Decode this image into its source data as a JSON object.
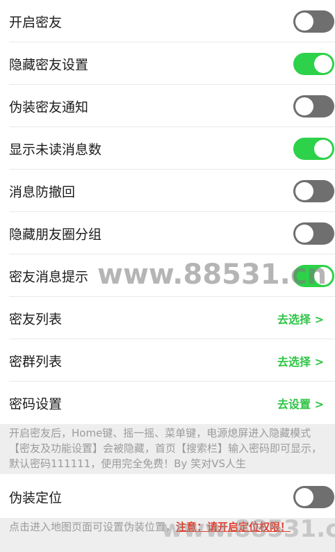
{
  "settings": [
    {
      "label": "开启密友",
      "type": "toggle",
      "on": false
    },
    {
      "label": "隐藏密友设置",
      "type": "toggle",
      "on": true
    },
    {
      "label": "伪装密友通知",
      "type": "toggle",
      "on": false
    },
    {
      "label": "显示未读消息数",
      "type": "toggle",
      "on": true
    },
    {
      "label": "消息防撤回",
      "type": "toggle",
      "on": false
    },
    {
      "label": "隐藏朋友圈分组",
      "type": "toggle",
      "on": false
    },
    {
      "label": "密友消息提示",
      "type": "toggle",
      "on": true
    },
    {
      "label": "密友列表",
      "type": "link",
      "action": "去选择 >"
    },
    {
      "label": "密群列表",
      "type": "link",
      "action": "去选择 >"
    },
    {
      "label": "密码设置",
      "type": "link",
      "action": "去设置 >"
    }
  ],
  "note_main": "开启密友后，Home键、摇一摇、菜单键，电源熄屏进入隐藏模式【密友及功能设置】会被隐藏，首页【搜索栏】输入密码即可显示，默认密码111111，使用完全免费！By 笑对VS人生",
  "fake_location": {
    "label": "伪装定位",
    "on": false
  },
  "note_location": "点击进入地图页面可设置伪装位置，",
  "note_location_warn": "注意：请开启定位权限！",
  "watermark_text": "www.88531.cn",
  "colors": {
    "toggle_on": "#2ed14a",
    "toggle_off": "#6f6f6f",
    "link": "#2ec445",
    "warn": "#e23b2a"
  }
}
